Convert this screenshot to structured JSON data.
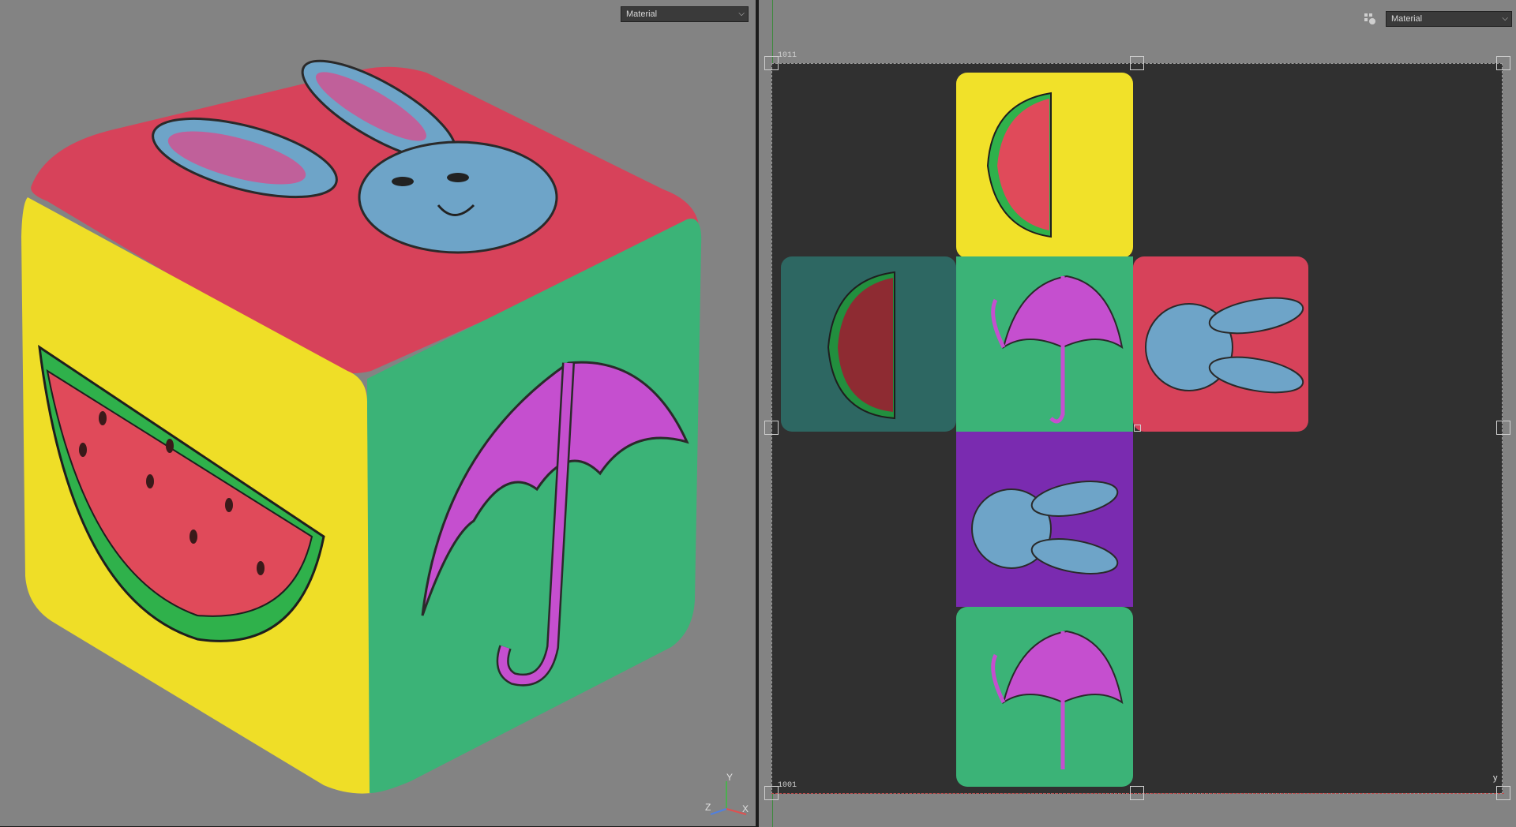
{
  "viewport_3d": {
    "shading_mode": "Material",
    "gizmo": {
      "y": "Y",
      "z": "Z",
      "x": "X"
    }
  },
  "viewport_2d": {
    "shading_mode": "Material",
    "tile_top": "1011",
    "tile_bottom": "1001",
    "gizmo_y": "y"
  },
  "colors": {
    "viewport_bg": "#838383",
    "uv_bg": "#303030",
    "yellow": "#f4e12a",
    "red": "#d94456",
    "green": "#3fb57a",
    "purple": "#7a2bb0",
    "rabbit_blue": "#6fa6c9",
    "umbrella_magenta": "#c34fd0"
  },
  "faces": [
    "rabbit",
    "watermelon",
    "umbrella",
    "watermelon",
    "umbrella",
    "rabbit",
    "rabbit",
    "umbrella"
  ]
}
